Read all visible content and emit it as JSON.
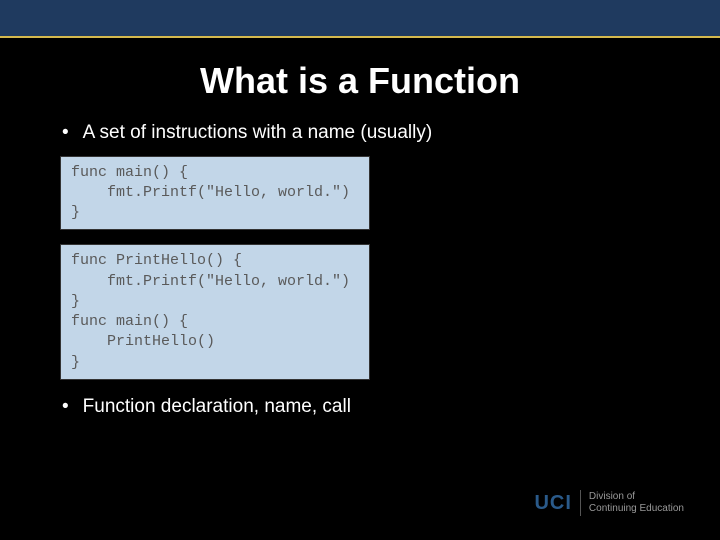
{
  "title": "What is a Function",
  "bullets": [
    "A set of instructions with a name (usually)",
    "Function declaration, name, call"
  ],
  "code1": "func main() {\n    fmt.Printf(\"Hello, world.\")\n}",
  "code2": "func PrintHello() {\n    fmt.Printf(\"Hello, world.\")\n}\nfunc main() {\n    PrintHello()\n}",
  "logo": {
    "brand": "UCI",
    "line1": "Division of",
    "line2": "Continuing Education"
  }
}
